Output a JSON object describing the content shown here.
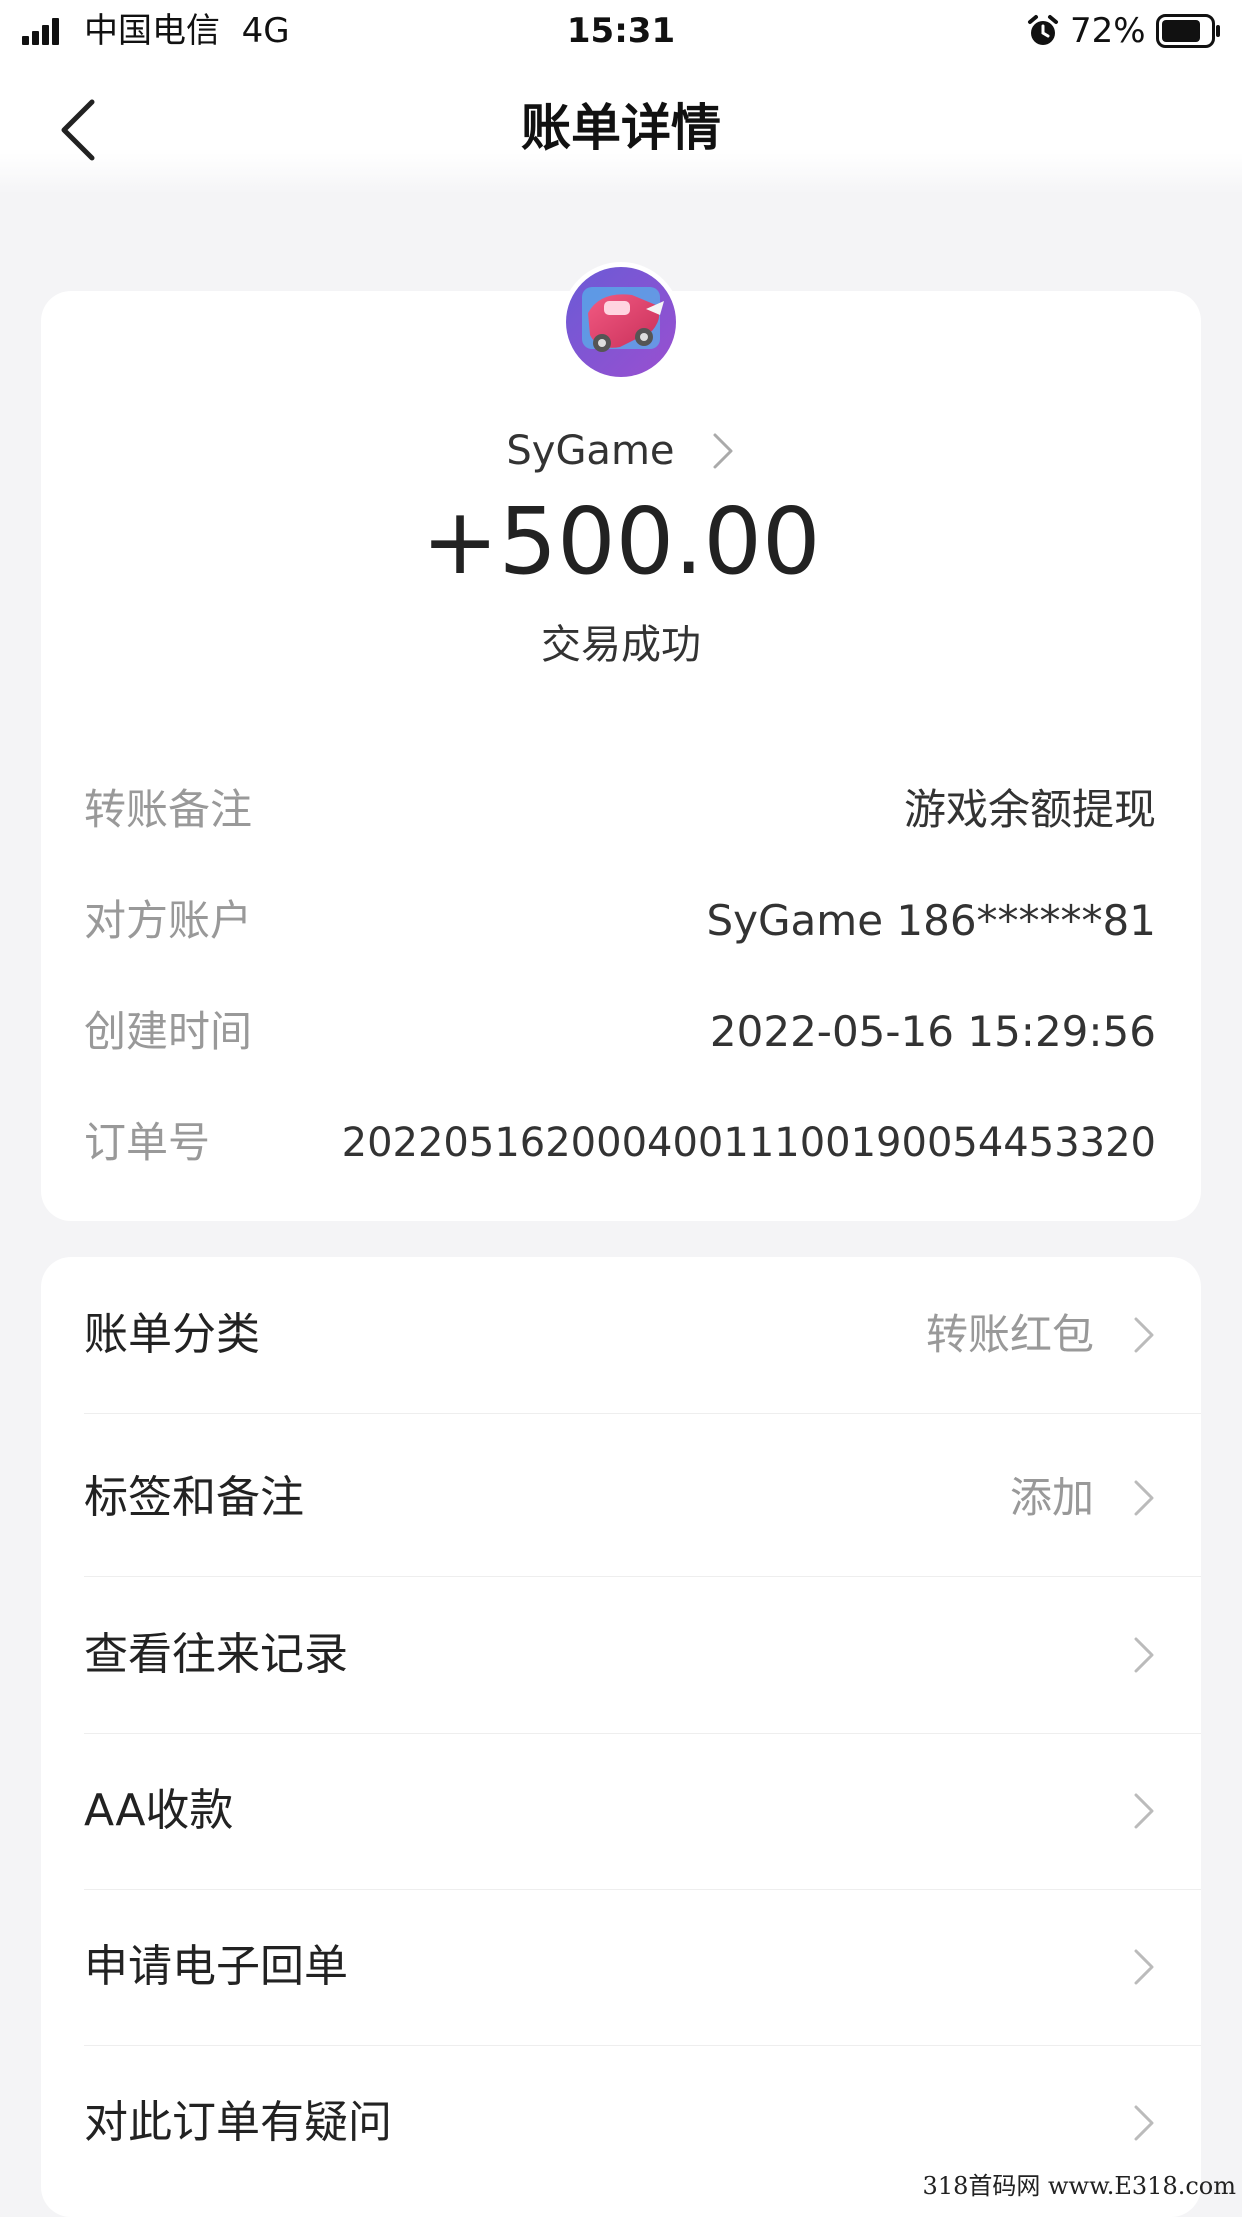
{
  "status_bar": {
    "carrier": "中国电信",
    "network": "4G",
    "time": "15:31",
    "battery": "72%",
    "icons": [
      "signal-icon",
      "alarm-icon",
      "battery-icon"
    ]
  },
  "nav": {
    "back_icon": "chevron-left-icon",
    "title": "账单详情"
  },
  "summary": {
    "avatar_icon": "game-app-avatar",
    "payee": "SyGame",
    "amount": "+500.00",
    "status": "交易成功"
  },
  "details": [
    {
      "label": "转账备注",
      "value": "游戏余额提现"
    },
    {
      "label": "对方账户",
      "value": "SyGame 186******81"
    },
    {
      "label": "创建时间",
      "value": "2022-05-16 15:29:56"
    },
    {
      "label": "订单号",
      "value": "20220516200040011100190054453320"
    }
  ],
  "actions": [
    {
      "label": "账单分类",
      "value": "转账红包"
    },
    {
      "label": "标签和备注",
      "value": "添加"
    },
    {
      "label": "查看往来记录",
      "value": ""
    },
    {
      "label": "AA收款",
      "value": ""
    },
    {
      "label": "申请电子回单",
      "value": ""
    },
    {
      "label": "对此订单有疑问",
      "value": ""
    }
  ],
  "watermark": "318首码网 www.E318.com",
  "colors": {
    "background": "#f4f4f6",
    "card": "#ffffff",
    "primary_text": "#333333",
    "secondary_text": "#999999"
  }
}
